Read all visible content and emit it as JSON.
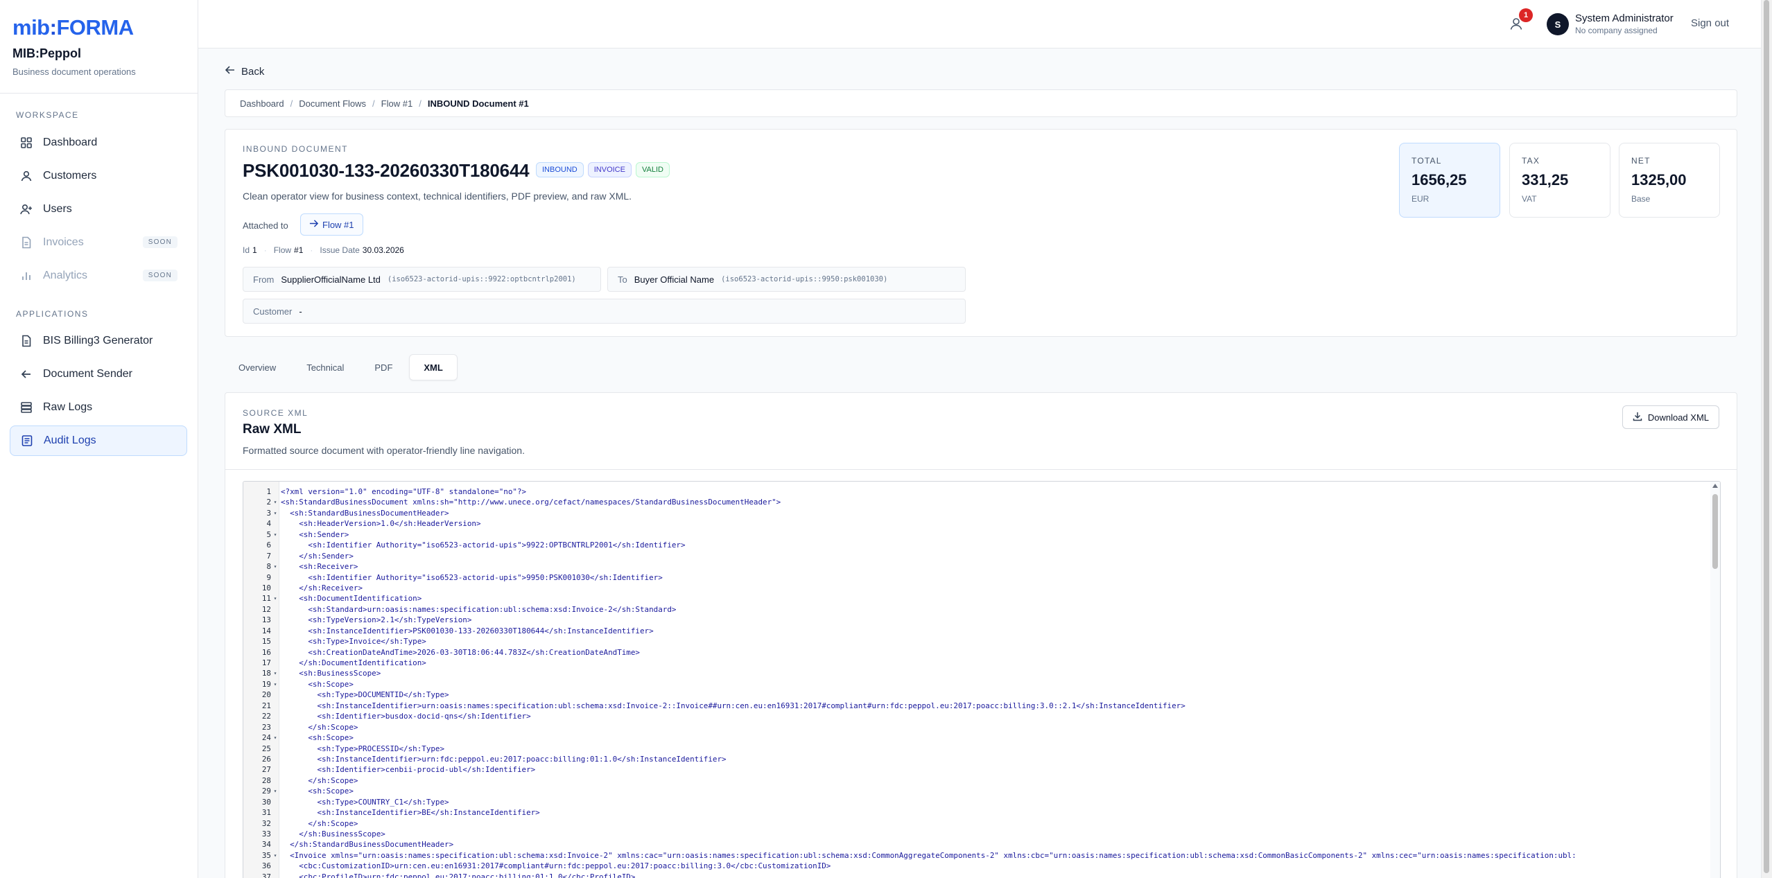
{
  "brand": {
    "logo_left": "mib",
    "logo_colon": ":",
    "logo_right": "FORMA",
    "app_name": "MIB:Peppol",
    "app_sub": "Business document operations",
    "accent": "#2563eb"
  },
  "sidebar": {
    "workspace_label": "WORKSPACE",
    "applications_label": "APPLICATIONS",
    "workspace_items": [
      {
        "label": "Dashboard",
        "icon": "grid-icon"
      },
      {
        "label": "Customers",
        "icon": "user-icon"
      },
      {
        "label": "Users",
        "icon": "user-plus-icon"
      },
      {
        "label": "Invoices",
        "icon": "document-icon",
        "badge": "SOON"
      },
      {
        "label": "Analytics",
        "icon": "bar-chart-icon",
        "badge": "SOON"
      }
    ],
    "application_items": [
      {
        "label": "BIS Billing3 Generator",
        "icon": "document-icon"
      },
      {
        "label": "Document Sender",
        "icon": "arrow-left-icon"
      },
      {
        "label": "Raw Logs",
        "icon": "server-icon"
      },
      {
        "label": "Audit Logs",
        "icon": "list-icon"
      }
    ]
  },
  "topbar": {
    "notification_count": "1",
    "avatar_initial": "S",
    "user_name": "System Administrator",
    "user_sub": "No company assigned",
    "signout": "Sign out"
  },
  "back_label": "Back",
  "breadcrumb": [
    "Dashboard",
    "Document Flows",
    "Flow #1",
    "INBOUND Document #1"
  ],
  "document": {
    "eyebrow": "INBOUND DOCUMENT",
    "title": "PSK001030-133-20260330T180644",
    "badges": [
      "INBOUND",
      "INVOICE",
      "VALID"
    ],
    "description": "Clean operator view for business context, technical identifiers, PDF preview, and raw XML.",
    "attached_label": "Attached to",
    "attached_value": "Flow #1",
    "meta": {
      "id_label": "Id",
      "id": "1",
      "flow_label": "Flow",
      "flow": "#1",
      "issue_label": "Issue Date",
      "issue": "30.03.2026"
    },
    "from": {
      "label": "From",
      "name": "SupplierOfficialName Ltd",
      "id": "(iso6523-actorid-upis::9922:optbcntrlp2001)"
    },
    "to": {
      "label": "To",
      "name": "Buyer Official Name",
      "id": "(iso6523-actorid-upis::9950:psk001030)"
    },
    "customer": {
      "label": "Customer",
      "value": "-"
    }
  },
  "stats": [
    {
      "label": "TOTAL",
      "value": "1656,25",
      "unit": "EUR"
    },
    {
      "label": "TAX",
      "value": "331,25",
      "unit": "VAT"
    },
    {
      "label": "NET",
      "value": "1325,00",
      "unit": "Base"
    }
  ],
  "tabs": [
    "Overview",
    "Technical",
    "PDF",
    "XML"
  ],
  "active_tab": "XML",
  "xml_panel": {
    "eyebrow": "SOURCE XML",
    "title": "Raw XML",
    "description": "Formatted source document with operator-friendly line navigation.",
    "download": "Download XML"
  },
  "xml_lines": [
    {
      "n": "1",
      "f": "",
      "t": "<?xml version=\"1.0\" encoding=\"UTF-8\" standalone=\"no\"?>"
    },
    {
      "n": "2",
      "f": "▾",
      "t": "<sh:StandardBusinessDocument xmlns:sh=\"http://www.unece.org/cefact/namespaces/StandardBusinessDocumentHeader\">"
    },
    {
      "n": "3",
      "f": "▾",
      "t": "  <sh:StandardBusinessDocumentHeader>"
    },
    {
      "n": "4",
      "f": "",
      "t": "    <sh:HeaderVersion>1.0</sh:HeaderVersion>"
    },
    {
      "n": "5",
      "f": "▾",
      "t": "    <sh:Sender>"
    },
    {
      "n": "6",
      "f": "",
      "t": "      <sh:Identifier Authority=\"iso6523-actorid-upis\">9922:OPTBCNTRLP2001</sh:Identifier>"
    },
    {
      "n": "7",
      "f": "",
      "t": "    </sh:Sender>"
    },
    {
      "n": "8",
      "f": "▾",
      "t": "    <sh:Receiver>"
    },
    {
      "n": "9",
      "f": "",
      "t": "      <sh:Identifier Authority=\"iso6523-actorid-upis\">9950:PSK001030</sh:Identifier>"
    },
    {
      "n": "10",
      "f": "",
      "t": "    </sh:Receiver>"
    },
    {
      "n": "11",
      "f": "▾",
      "t": "    <sh:DocumentIdentification>"
    },
    {
      "n": "12",
      "f": "",
      "t": "      <sh:Standard>urn:oasis:names:specification:ubl:schema:xsd:Invoice-2</sh:Standard>"
    },
    {
      "n": "13",
      "f": "",
      "t": "      <sh:TypeVersion>2.1</sh:TypeVersion>"
    },
    {
      "n": "14",
      "f": "",
      "t": "      <sh:InstanceIdentifier>PSK001030-133-20260330T180644</sh:InstanceIdentifier>"
    },
    {
      "n": "15",
      "f": "",
      "t": "      <sh:Type>Invoice</sh:Type>"
    },
    {
      "n": "16",
      "f": "",
      "t": "      <sh:CreationDateAndTime>2026-03-30T18:06:44.783Z</sh:CreationDateAndTime>"
    },
    {
      "n": "17",
      "f": "",
      "t": "    </sh:DocumentIdentification>"
    },
    {
      "n": "18",
      "f": "▾",
      "t": "    <sh:BusinessScope>"
    },
    {
      "n": "19",
      "f": "▾",
      "t": "      <sh:Scope>"
    },
    {
      "n": "20",
      "f": "",
      "t": "        <sh:Type>DOCUMENTID</sh:Type>"
    },
    {
      "n": "21",
      "f": "",
      "t": "        <sh:InstanceIdentifier>urn:oasis:names:specification:ubl:schema:xsd:Invoice-2::Invoice##urn:cen.eu:en16931:2017#compliant#urn:fdc:peppol.eu:2017:poacc:billing:3.0::2.1</sh:InstanceIdentifier>"
    },
    {
      "n": "22",
      "f": "",
      "t": "        <sh:Identifier>busdox-docid-qns</sh:Identifier>"
    },
    {
      "n": "23",
      "f": "",
      "t": "      </sh:Scope>"
    },
    {
      "n": "24",
      "f": "▾",
      "t": "      <sh:Scope>"
    },
    {
      "n": "25",
      "f": "",
      "t": "        <sh:Type>PROCESSID</sh:Type>"
    },
    {
      "n": "26",
      "f": "",
      "t": "        <sh:InstanceIdentifier>urn:fdc:peppol.eu:2017:poacc:billing:01:1.0</sh:InstanceIdentifier>"
    },
    {
      "n": "27",
      "f": "",
      "t": "        <sh:Identifier>cenbii-procid-ubl</sh:Identifier>"
    },
    {
      "n": "28",
      "f": "",
      "t": "      </sh:Scope>"
    },
    {
      "n": "29",
      "f": "▾",
      "t": "      <sh:Scope>"
    },
    {
      "n": "30",
      "f": "",
      "t": "        <sh:Type>COUNTRY_C1</sh:Type>"
    },
    {
      "n": "31",
      "f": "",
      "t": "        <sh:InstanceIdentifier>BE</sh:InstanceIdentifier>"
    },
    {
      "n": "32",
      "f": "",
      "t": "      </sh:Scope>"
    },
    {
      "n": "33",
      "f": "",
      "t": "    </sh:BusinessScope>"
    },
    {
      "n": "34",
      "f": "",
      "t": "  </sh:StandardBusinessDocumentHeader>"
    },
    {
      "n": "35",
      "f": "▾",
      "t": "  <Invoice xmlns=\"urn:oasis:names:specification:ubl:schema:xsd:Invoice-2\" xmlns:cac=\"urn:oasis:names:specification:ubl:schema:xsd:CommonAggregateComponents-2\" xmlns:cbc=\"urn:oasis:names:specification:ubl:schema:xsd:CommonBasicComponents-2\" xmlns:cec=\"urn:oasis:names:specification:ubl:"
    },
    {
      "n": "36",
      "f": "",
      "t": "    <cbc:CustomizationID>urn:cen.eu:en16931:2017#compliant#urn:fdc:peppol.eu:2017:poacc:billing:3.0</cbc:CustomizationID>"
    },
    {
      "n": "37",
      "f": "",
      "t": "    <cbc:ProfileID>urn:fdc:peppol.eu:2017:poacc:billing:01:1.0</cbc:ProfileID>"
    }
  ]
}
